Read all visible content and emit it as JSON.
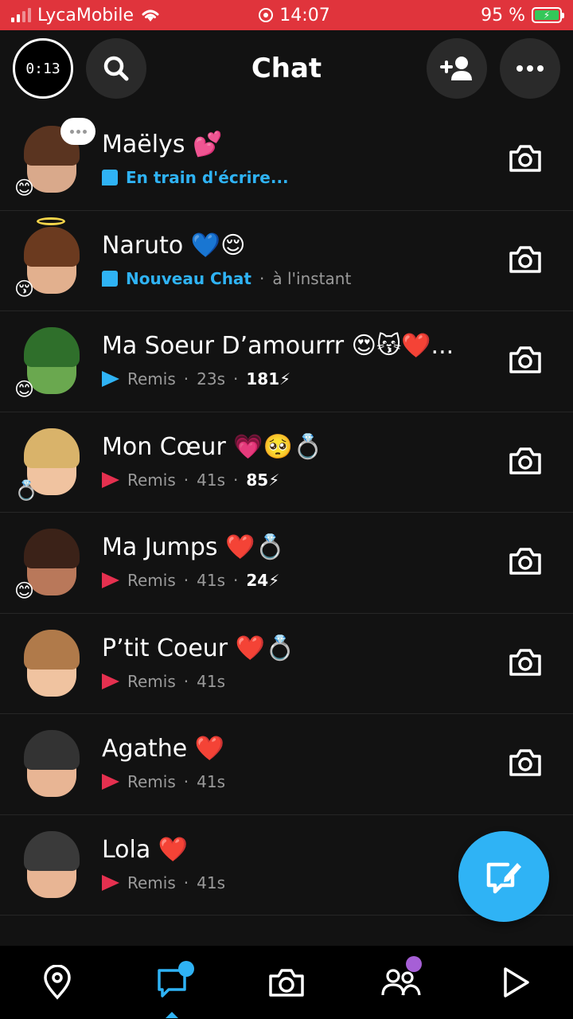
{
  "status_bar": {
    "carrier": "LycaMobile",
    "time": "14:07",
    "battery": "95 %"
  },
  "header": {
    "timer": "0:13",
    "title": "Chat"
  },
  "chats": [
    {
      "name": "Maëlys 💕",
      "status_label": "En train d'écrire...",
      "status_type": "typing",
      "time": "",
      "streak": "",
      "badge": "😊",
      "avatar_colors": {
        "skin": "#d9a98b",
        "hair": "#5a3420"
      }
    },
    {
      "name": "Naruto 💙😌",
      "status_label": "Nouveau Chat",
      "status_type": "new",
      "time": "à l'instant",
      "streak": "",
      "badge": "😚",
      "avatar_colors": {
        "skin": "#e2b08e",
        "hair": "#6b3a1f"
      }
    },
    {
      "name": "Ma Soeur D’amourrr 😍😽❤️...",
      "status_label": "Remis",
      "status_type": "delivered_blue",
      "time": "23s",
      "streak": "181⚡",
      "badge": "😊",
      "avatar_colors": {
        "skin": "#6aa84f",
        "hair": "#2f6f2b"
      }
    },
    {
      "name": "Mon Cœur 💗🥺💍",
      "status_label": "Remis",
      "status_type": "delivered_red",
      "time": "41s",
      "streak": "85⚡",
      "badge": "💍",
      "avatar_colors": {
        "skin": "#f0c3a0",
        "hair": "#d9b36a"
      }
    },
    {
      "name": "Ma Jumps ❤️💍",
      "status_label": "Remis",
      "status_type": "delivered_red",
      "time": "41s",
      "streak": "24⚡",
      "badge": "😊",
      "avatar_colors": {
        "skin": "#b9785a",
        "hair": "#3b2218"
      }
    },
    {
      "name": "P’tit Coeur ❤️💍",
      "status_label": "Remis",
      "status_type": "delivered_red",
      "time": "41s",
      "streak": "",
      "badge": "",
      "avatar_colors": {
        "skin": "#f0c3a0",
        "hair": "#b07a4a"
      }
    },
    {
      "name": "Agathe ❤️",
      "status_label": "Remis",
      "status_type": "delivered_red",
      "time": "41s",
      "streak": "",
      "badge": "",
      "avatar_colors": {
        "skin": "#e8b594",
        "hair": "#333333"
      }
    },
    {
      "name": "Lola ❤️",
      "status_label": "Remis",
      "status_type": "delivered_red",
      "time": "41s",
      "streak": "",
      "badge": "",
      "avatar_colors": {
        "skin": "#e8b594",
        "hair": "#3a3a3a"
      }
    }
  ],
  "colors": {
    "status_bar": "#e0343c",
    "accent_blue": "#2fb3f5",
    "delivered_red": "#e5304f",
    "background": "#121212",
    "nav_dot_purple": "#a65fd6"
  },
  "icons": {
    "search": "search-icon",
    "add_friend": "add-friend-icon",
    "more": "more-icon",
    "camera": "camera-icon",
    "new_chat": "new-chat-icon",
    "nav": [
      "map-icon",
      "chat-icon",
      "camera-icon",
      "friends-icon",
      "play-icon"
    ]
  }
}
